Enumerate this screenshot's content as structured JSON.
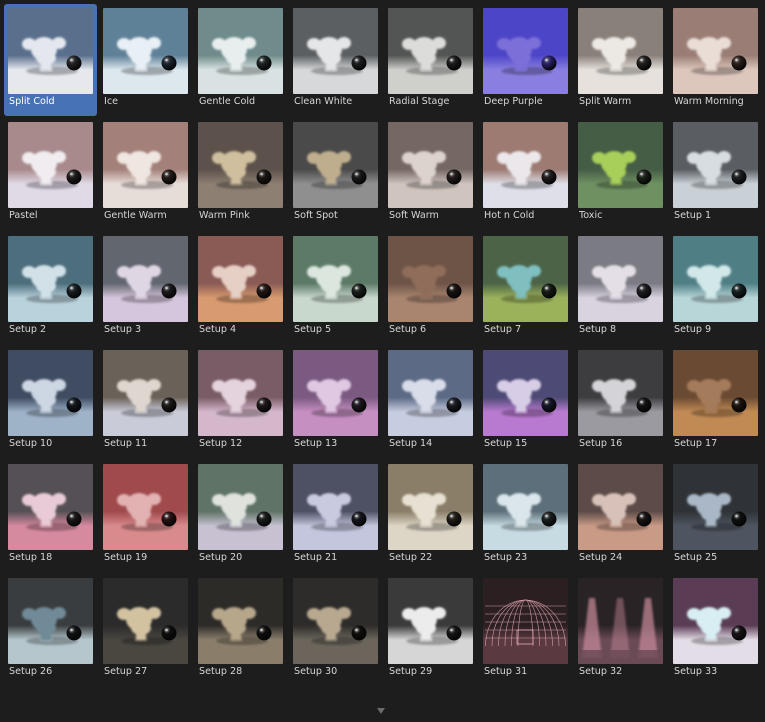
{
  "presets": [
    {
      "label": "Split Cold",
      "selected": true,
      "top": "#5a6f8c",
      "floor": "#e6e8ee",
      "mk": "#e4e7ee",
      "sphere": "#222326",
      "kind": "standard"
    },
    {
      "label": "Ice",
      "top": "#5f8198",
      "floor": "#dde7ee",
      "mk": "#e8f0f5",
      "sphere": "#1d2630",
      "kind": "standard"
    },
    {
      "label": "Gentle Cold",
      "top": "#6f8b8b",
      "floor": "#d9e2e2",
      "mk": "#e8eeee",
      "sphere": "#1e2424",
      "kind": "standard"
    },
    {
      "label": "Clean White",
      "top": "#5b5f62",
      "floor": "#d6d8d9",
      "mk": "#e5e6e7",
      "sphere": "#1c1d1e",
      "kind": "standard"
    },
    {
      "label": "Radial Stage",
      "top": "#525553",
      "floor": "#cfcfcc",
      "mk": "#dcdcda",
      "sphere": "#1b1b1b",
      "kind": "standard"
    },
    {
      "label": "Deep Purple",
      "top": "#4d45c8",
      "floor": "#8a7fe0",
      "mk": "#7b6fd8",
      "sphere": "#2a2470",
      "kind": "standard"
    },
    {
      "label": "Split Warm",
      "top": "#8a807a",
      "floor": "#e6e1dc",
      "mk": "#ece8e4",
      "sphere": "#221e1b",
      "kind": "standard"
    },
    {
      "label": "Warm Morning",
      "top": "#9a7e76",
      "floor": "#ddc7bd",
      "mk": "#e9ddd6",
      "sphere": "#2a1f1a",
      "kind": "standard"
    },
    {
      "label": "Pastel",
      "top": "#a88a8c",
      "floor": "#e0d9e6",
      "mk": "#f0ecef",
      "sphere": "#201b1d",
      "kind": "standard"
    },
    {
      "label": "Gentle Warm",
      "top": "#a4807a",
      "floor": "#e7ddd8",
      "mk": "#f0e6e1",
      "sphere": "#241c19",
      "kind": "standard"
    },
    {
      "label": "Warm Pink",
      "top": "#5d524b",
      "floor": "#8d7f71",
      "mk": "#cfbf9e",
      "sphere": "#1c1714",
      "kind": "standard"
    },
    {
      "label": "Soft Spot",
      "top": "#4a4a4a",
      "floor": "#8f8f8f",
      "mk": "#bfae8d",
      "sphere": "#1a1a1a",
      "kind": "standard"
    },
    {
      "label": "Soft Warm",
      "top": "#756864",
      "floor": "#cfc4be",
      "mk": "#ddd3ce",
      "sphere": "#221c1a",
      "kind": "standard"
    },
    {
      "label": "Hot n Cold",
      "top": "#9d7a72",
      "floor": "#dedfe8",
      "mk": "#ece7ea",
      "sphere": "#221d1e",
      "kind": "standard"
    },
    {
      "label": "Toxic",
      "top": "#455c45",
      "floor": "#6f9162",
      "mk": "#a8cf5a",
      "sphere": "#1b2319",
      "kind": "standard"
    },
    {
      "label": "Setup 1",
      "top": "#5a5e63",
      "floor": "#c9d1d6",
      "mk": "#d7dde1",
      "sphere": "#1d1f21",
      "kind": "standard"
    },
    {
      "label": "Setup 2",
      "top": "#4d6e7d",
      "floor": "#b9d2dc",
      "mk": "#d2e1e8",
      "sphere": "#171e22",
      "kind": "standard"
    },
    {
      "label": "Setup 3",
      "top": "#62666f",
      "floor": "#d6c6dd",
      "mk": "#dfd6e3",
      "sphere": "#1c1b1f",
      "kind": "standard"
    },
    {
      "label": "Setup 4",
      "top": "#8a5a55",
      "floor": "#d89a6f",
      "mk": "#e6cfc4",
      "sphere": "#241815",
      "kind": "standard"
    },
    {
      "label": "Setup 5",
      "top": "#5d7a67",
      "floor": "#c9d8cd",
      "mk": "#dbe6de",
      "sphere": "#1a211c",
      "kind": "standard"
    },
    {
      "label": "Setup 6",
      "top": "#6e5447",
      "floor": "#a98570",
      "mk": "#8f6d5a",
      "sphere": "#1a130f",
      "kind": "standard"
    },
    {
      "label": "Setup 7",
      "top": "#4c6347",
      "floor": "#9bb25a",
      "mk": "#7fbfc0",
      "sphere": "#161c15",
      "kind": "standard"
    },
    {
      "label": "Setup 8",
      "top": "#7b7b84",
      "floor": "#d9d2df",
      "mk": "#e4dfe6",
      "sphere": "#1f1e22",
      "kind": "standard"
    },
    {
      "label": "Setup 9",
      "top": "#4f7f85",
      "floor": "#b8d6d8",
      "mk": "#d1e7e8",
      "sphere": "#172324",
      "kind": "standard"
    },
    {
      "label": "Setup 10",
      "top": "#3f4c62",
      "floor": "#9eb2c8",
      "mk": "#cdd7e3",
      "sphere": "#121720",
      "kind": "standard"
    },
    {
      "label": "Setup 11",
      "top": "#6a6158",
      "floor": "#c9cbd8",
      "mk": "#ddd7cf",
      "sphere": "#1c1916",
      "kind": "standard"
    },
    {
      "label": "Setup 12",
      "top": "#7a5c66",
      "floor": "#d4b7cb",
      "mk": "#e4d3dc",
      "sphere": "#20181b",
      "kind": "standard"
    },
    {
      "label": "Setup 13",
      "top": "#7a5a80",
      "floor": "#c58fc2",
      "mk": "#e0c7e2",
      "sphere": "#1f1621",
      "kind": "standard"
    },
    {
      "label": "Setup 14",
      "top": "#5c6a85",
      "floor": "#c7cde0",
      "mk": "#d8dde9",
      "sphere": "#191c24",
      "kind": "standard"
    },
    {
      "label": "Setup 15",
      "top": "#4d4a75",
      "floor": "#b87ad0",
      "mk": "#d7cde6",
      "sphere": "#17162a",
      "kind": "standard"
    },
    {
      "label": "Setup 16",
      "top": "#3d3d40",
      "floor": "#9a9aa0",
      "mk": "#d4d4d8",
      "sphere": "#131314",
      "kind": "standard"
    },
    {
      "label": "Setup 17",
      "top": "#6b4a33",
      "floor": "#c08a55",
      "mk": "#a47c5b",
      "sphere": "#1c130c",
      "kind": "standard"
    },
    {
      "label": "Setup 18",
      "top": "#555055",
      "floor": "#d68aa0",
      "mk": "#e8cbd6",
      "sphere": "#1a181a",
      "kind": "standard"
    },
    {
      "label": "Setup 19",
      "top": "#a04a4c",
      "floor": "#d98a8c",
      "mk": "#e2b2b3",
      "sphere": "#2a1213",
      "kind": "standard"
    },
    {
      "label": "Setup 20",
      "top": "#5f7366",
      "floor": "#c8c1d2",
      "mk": "#dfe2dd",
      "sphere": "#1a1e1b",
      "kind": "standard"
    },
    {
      "label": "Setup 21",
      "top": "#4e5064",
      "floor": "#c3c6dd",
      "mk": "#c9c9e0",
      "sphere": "#16171d",
      "kind": "standard"
    },
    {
      "label": "Setup 22",
      "top": "#8a7e68",
      "floor": "#ddd6c6",
      "mk": "#e7e1d3",
      "sphere": "#221e17",
      "kind": "standard"
    },
    {
      "label": "Setup 23",
      "top": "#5c6f7a",
      "floor": "#c7dbe2",
      "mk": "#dae6ea",
      "sphere": "#19201f",
      "kind": "standard"
    },
    {
      "label": "Setup 24",
      "top": "#5c4b48",
      "floor": "#c99a86",
      "mk": "#d7c1b8",
      "sphere": "#1a1413",
      "kind": "standard"
    },
    {
      "label": "Setup 25",
      "top": "#2f3236",
      "floor": "#4e5560",
      "mk": "#a9b7c6",
      "sphere": "#0f1011",
      "kind": "standard"
    },
    {
      "label": "Setup 26",
      "top": "#3a3d3f",
      "floor": "#b5c7cd",
      "mk": "#6f8b97",
      "sphere": "#111213",
      "kind": "standard"
    },
    {
      "label": "Setup 27",
      "top": "#2b2b2b",
      "floor": "#4a4741",
      "mk": "#d2c2a0",
      "sphere": "#0e0e0e",
      "kind": "standard"
    },
    {
      "label": "Setup 28",
      "top": "#2d2b28",
      "floor": "#8a7e6a",
      "mk": "#b6a68a",
      "sphere": "#0f0e0d",
      "kind": "standard"
    },
    {
      "label": "Setup 30",
      "top": "#2e2c2a",
      "floor": "#6b655c",
      "mk": "#b8a890",
      "sphere": "#0f0e0d",
      "kind": "standard"
    },
    {
      "label": "Setup 29",
      "top": "#3a3a3a",
      "floor": "#d6d6d6",
      "mk": "#ececec",
      "sphere": "#151515",
      "kind": "standard"
    },
    {
      "label": "Setup 31",
      "top": "#2b1f22",
      "floor": "#5a3a40",
      "mk": "#e5a9b4",
      "sphere": "#130d0f",
      "kind": "dome"
    },
    {
      "label": "Setup 32",
      "top": "#2a2326",
      "floor": "#6a4a55",
      "mk": "#c88a9a",
      "sphere": "#120e10",
      "kind": "lights"
    },
    {
      "label": "Setup 33",
      "top": "#5a3c55",
      "floor": "#e3dde7",
      "mk": "#d8eef2",
      "sphere": "#181318",
      "kind": "standard"
    }
  ]
}
